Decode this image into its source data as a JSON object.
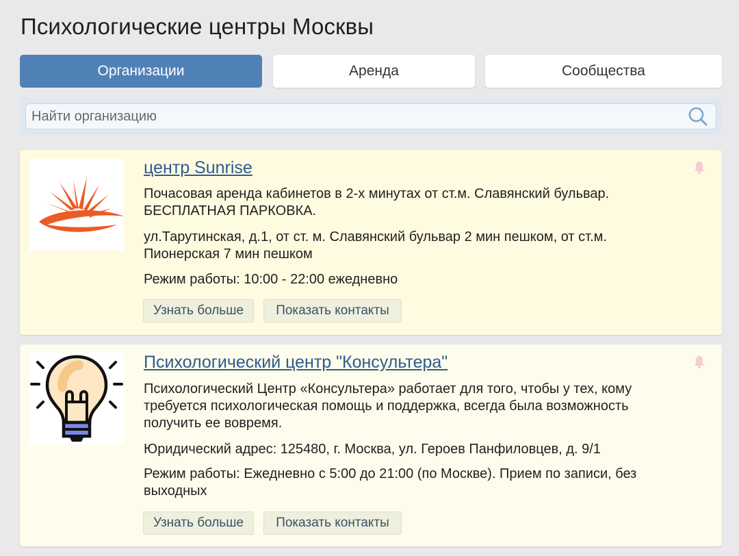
{
  "page": {
    "title": "Психологические центры Москвы"
  },
  "tabs": [
    {
      "label": "Организации",
      "active": true
    },
    {
      "label": "Аренда",
      "active": false
    },
    {
      "label": "Сообщества",
      "active": false
    }
  ],
  "search": {
    "placeholder": "Найти организацию",
    "value": ""
  },
  "colors": {
    "accent": "#5081b6",
    "link": "#2f5b8e",
    "card_bg": "#fefbe0"
  },
  "organizations": [
    {
      "name": "центр Sunrise",
      "logo_icon": "sunrise-logo-icon",
      "description": "Почасовая аренда кабинетов в 2-х минутах от ст.м. Славянский бульвар. БЕСПЛАТНАЯ ПАРКОВКА.",
      "address": "ул.Тарутинская, д.1, от ст. м. Славянский бульвар 2 мин пешком, от ст.м. Пионерская 7 мин пешком",
      "hours": "Режим работы: 10:00 - 22:00 ежедневно",
      "more_label": "Узнать больше",
      "contacts_label": "Показать контакты"
    },
    {
      "name": "Психологический центр \"Консультера\"",
      "logo_icon": "lightbulb-logo-icon",
      "description": "Психологический Центр «Консультера» работает для того, чтобы у тех, кому требуется психологическая помощь и поддержка, всегда была возможность получить ее вовремя.",
      "address": "Юридический адрес: 125480, г. Москва, ул. Героев Панфиловцев, д. 9/1",
      "hours": "Режим работы: Ежедневно с 5:00 до 21:00 (по Москве). Прием по записи, без выходных",
      "more_label": "Узнать больше",
      "contacts_label": "Показать контакты"
    }
  ]
}
